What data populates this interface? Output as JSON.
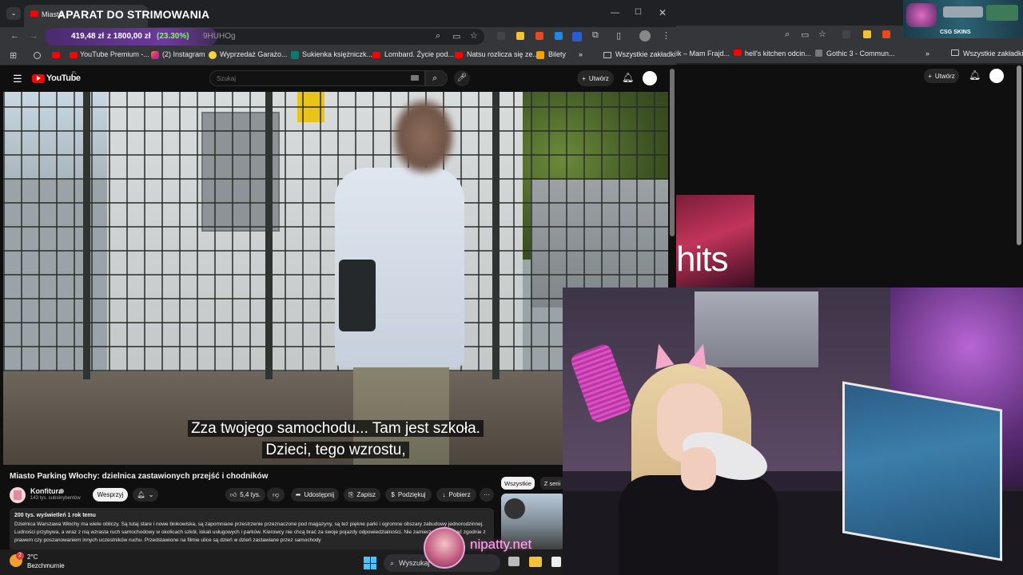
{
  "stream_label": "APARAT DO STRIMOWANIA",
  "main_browser": {
    "tab_title": "Miasto",
    "price_overlay": {
      "current": "419,48 zł",
      "of": "z 1800,00 zł",
      "percent": "(23.30%)"
    },
    "url_partial": "9HUHOg",
    "bookmarks": [
      "YouTube Premium -...",
      "(2) Instagram",
      "Wyprzedaż Garażo...",
      "Sukienka księżniczk...",
      "Lombard. Życie pod...",
      "Natsu rozlicza się ze...",
      "Bilety"
    ],
    "bookmarks_more": "»",
    "all_bookmarks": "Wszystkie zakładki"
  },
  "bg_browser": {
    "bookmarks": [
      "ik – Mam Frajd...",
      "hell's kitchen odcin...",
      "Gothic 3 - Commun..."
    ],
    "bookmarks_more": "»",
    "all_bookmarks": "Wszystkie zakładki",
    "create_label": "Utwórz",
    "thumb_text": "hits"
  },
  "youtube": {
    "logo": "YouTube",
    "logo_region": "PL",
    "search_placeholder": "Szukaj",
    "create_label": "Utwórz",
    "video": {
      "subtitle_line1": "Zza twojego samochodu... Tam jest szkoła.",
      "subtitle_line2": "Dzieci, tego wzrostu,",
      "title": "Miasto Parking Włochy: dzielnica zastawionych przejść i chodników"
    },
    "channel": {
      "name": "Konfitura",
      "subscribers": "143 tys. subskrybentów",
      "support_label": "Wesprzyj"
    },
    "actions": {
      "likes": "5,4 tys.",
      "share": "Udostępnij",
      "save": "Zapisz",
      "thanks": "Podziękuj",
      "download": "Pobierz",
      "more": "···"
    },
    "description": {
      "meta": "200 tys. wyświetleń  1 rok temu",
      "text": "Dzielnica Warszawa Włochy ma wiele obliczy. Są tutaj stare i nowe blokowiska, są zapomniane przestrzenie przeznaczone pod magazyny, są też piękne parki i ogromne obszary zabudowy jednorodzinnej. Ludności przybywa, a wraz z nią wzrasta ruch samochodowy w okolicach szkół, lokali usługowych i parków. Kierowcy nie chcą brać za swoje pojazdy odpowiedzialności. Nie zamierzają parkować zgodnie z prawem czy poszanowaniem innych uczestników ruchu. Przedstawione na filmie ulice są dzień w dzień zastawiane przez samochody"
    },
    "chips": [
      "Wszystkie",
      "Z serii"
    ]
  },
  "overlay": {
    "streamer_name": "nipatty.net"
  },
  "widget": {
    "label": "CSG SKINS"
  },
  "taskbar": {
    "weather_badge": "2",
    "temperature": "2°C",
    "condition": "Bezchmurnie",
    "search": "Wyszukaj"
  },
  "colors": {
    "youtube_red": "#ff0000",
    "overlay_pink": "#f4b4ea",
    "price_green": "#7cff5a"
  }
}
